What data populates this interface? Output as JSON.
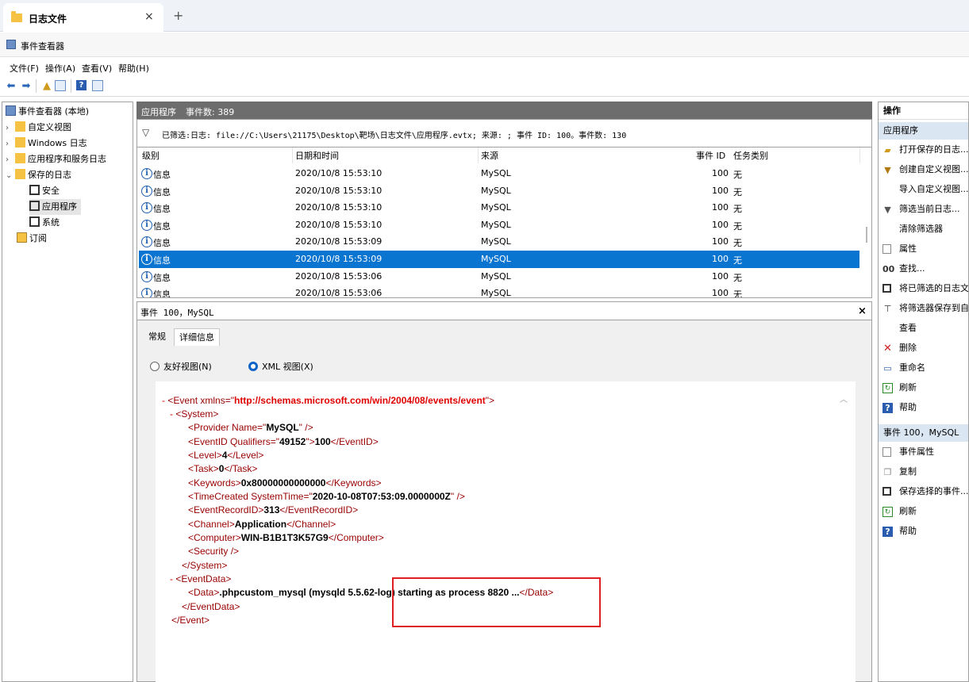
{
  "tab": {
    "title": "日志文件",
    "close": "×",
    "new": "+"
  },
  "app": {
    "title": "事件查看器"
  },
  "menu": [
    "文件(F)",
    "操作(A)",
    "查看(V)",
    "帮助(H)"
  ],
  "tree": {
    "root": "事件查看器 (本地)",
    "custom_views": "自定义视图",
    "windows_logs": "Windows 日志",
    "app_service_logs": "应用程序和服务日志",
    "saved_logs": "保存的日志",
    "saved_children": [
      "安全",
      "应用程序",
      "系统"
    ],
    "subscriptions": "订阅"
  },
  "list": {
    "header_name": "应用程序",
    "header_count": "事件数: 389",
    "filter_text": "已筛选:日志: file://C:\\Users\\21175\\Desktop\\靶场\\日志文件\\应用程序.evtx; 来源: ; 事件 ID: 100。事件数: 130",
    "columns": [
      "级别",
      "日期和时间",
      "来源",
      "事件 ID",
      "任务类别"
    ],
    "rows": [
      {
        "level": "信息",
        "datetime": "2020/10/8 15:53:10",
        "source": "MySQL",
        "id": "100",
        "task": "无"
      },
      {
        "level": "信息",
        "datetime": "2020/10/8 15:53:10",
        "source": "MySQL",
        "id": "100",
        "task": "无"
      },
      {
        "level": "信息",
        "datetime": "2020/10/8 15:53:10",
        "source": "MySQL",
        "id": "100",
        "task": "无"
      },
      {
        "level": "信息",
        "datetime": "2020/10/8 15:53:10",
        "source": "MySQL",
        "id": "100",
        "task": "无"
      },
      {
        "level": "信息",
        "datetime": "2020/10/8 15:53:09",
        "source": "MySQL",
        "id": "100",
        "task": "无"
      },
      {
        "level": "信息",
        "datetime": "2020/10/8 15:53:09",
        "source": "MySQL",
        "id": "100",
        "task": "无"
      },
      {
        "level": "信息",
        "datetime": "2020/10/8 15:53:06",
        "source": "MySQL",
        "id": "100",
        "task": "无"
      },
      {
        "level": "信息",
        "datetime": "2020/10/8 15:53:06",
        "source": "MySQL",
        "id": "100",
        "task": "无"
      }
    ]
  },
  "detail": {
    "title": "事件 100，MySQL",
    "close": "×",
    "tabs": [
      "常规",
      "详细信息"
    ],
    "view_friendly": "友好视图(N)",
    "view_xml": "XML 视图(X)",
    "xml": {
      "event_ns": "http://schemas.microsoft.com/win/2004/08/events/event",
      "provider_name": "MySQL",
      "qualifiers": "49152",
      "event_id": "100",
      "level": "4",
      "task": "0",
      "keywords": "0x80000000000000",
      "system_time": "2020-10-08T07:53:09.0000000Z",
      "record_id": "313",
      "channel": "Application",
      "computer": "WIN-B1B1T3K57G9",
      "data": ".phpcustom_mysql (mysqld 5.5.62-log) starting as process 8820 ..."
    }
  },
  "actions": {
    "header": "操作",
    "section1": "应用程序",
    "items1": [
      "打开保存的日志...",
      "创建自定义视图...",
      "导入自定义视图...",
      "筛选当前日志...",
      "清除筛选器",
      "属性",
      "查找...",
      "将已筛选的日志文件",
      "将筛选器保存到自定",
      "查看",
      "删除",
      "重命名",
      "刷新",
      "帮助"
    ],
    "section2": "事件 100，MySQL",
    "items2": [
      "事件属性",
      "复制",
      "保存选择的事件...",
      "刷新",
      "帮助"
    ]
  }
}
